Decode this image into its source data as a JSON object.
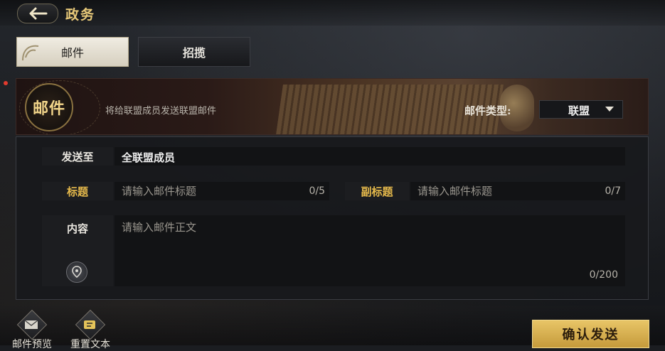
{
  "header": {
    "title": "政务",
    "back_icon": "arrow-left-icon"
  },
  "tabs": [
    {
      "label": "邮件",
      "active": true
    },
    {
      "label": "招揽",
      "active": false
    }
  ],
  "banner": {
    "seal_text": "邮件",
    "description": "将给联盟成员发送联盟邮件",
    "type_label": "邮件类型:",
    "type_value": "联盟"
  },
  "form": {
    "to_label": "发送至",
    "to_value": "全联盟成员",
    "title_label": "标题",
    "title_placeholder": "请输入邮件标题",
    "title_counter": "0/5",
    "subtitle_label": "副标题",
    "subtitle_placeholder": "请输入邮件标题",
    "subtitle_counter": "0/7",
    "content_label": "内容",
    "content_placeholder": "请输入邮件正文",
    "content_counter": "0/200"
  },
  "actions": {
    "preview_label": "邮件预览",
    "reset_label": "重置文本",
    "confirm_label": "确认发送"
  },
  "colors": {
    "accent_gold": "#e5b94b",
    "confirm_bg": "#d8b04f"
  }
}
